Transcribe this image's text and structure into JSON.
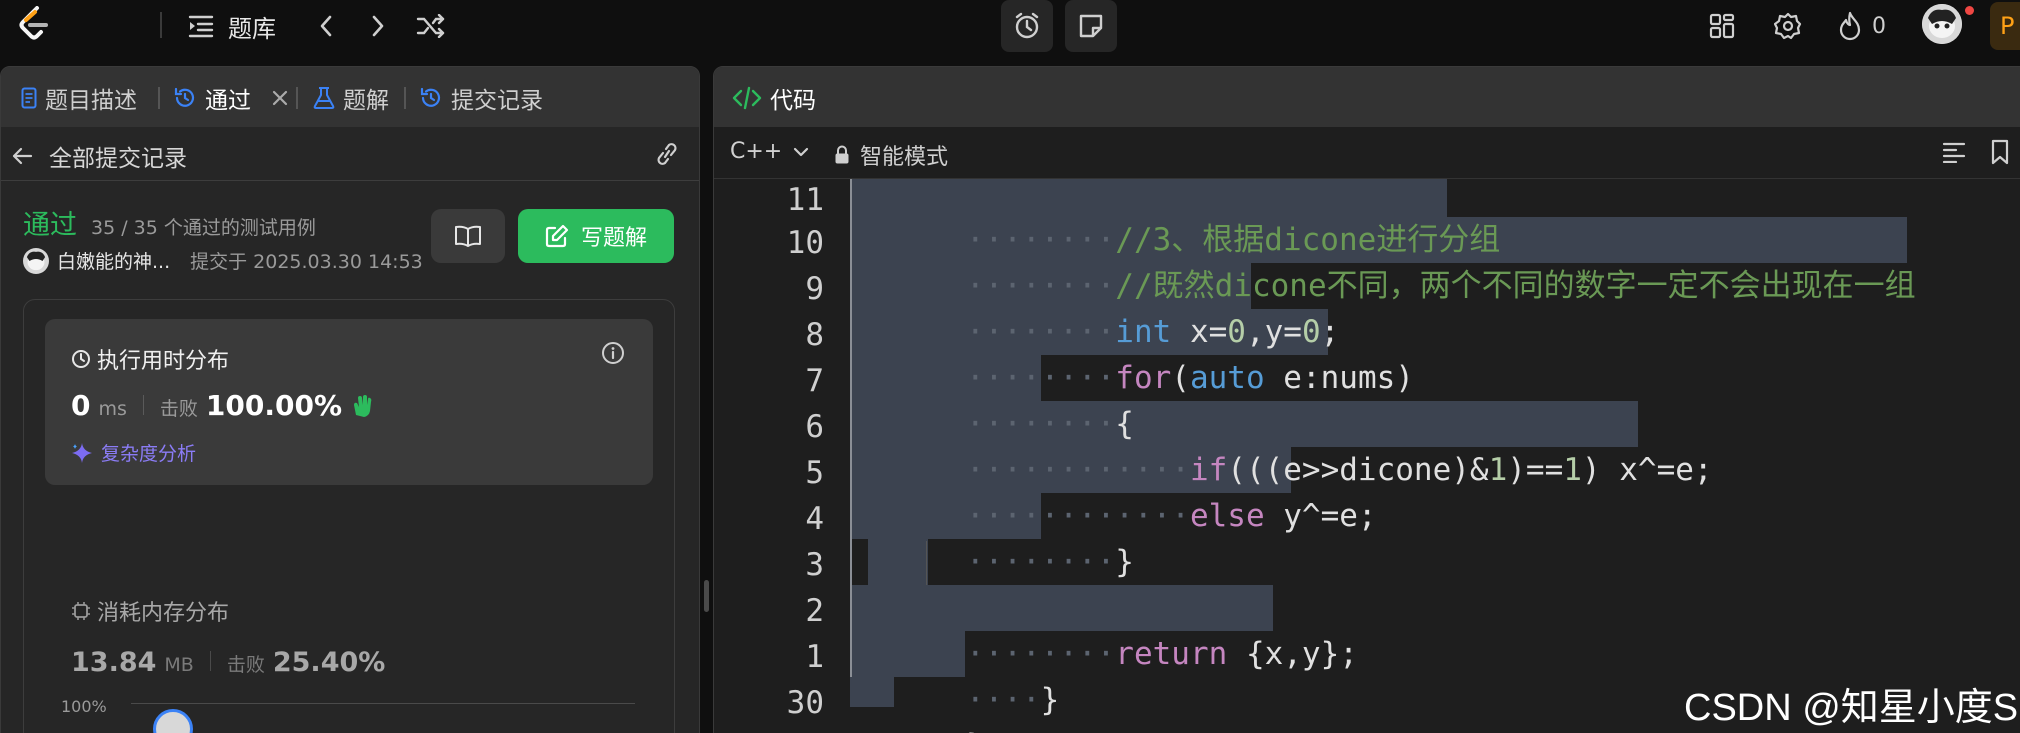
{
  "topbar": {
    "problem_list_label": "题库",
    "fire_count": "0",
    "premium_partial": "P"
  },
  "left_tabs": [
    {
      "label": "题目描述"
    },
    {
      "label": "通过"
    },
    {
      "label": "题解"
    },
    {
      "label": "提交记录"
    }
  ],
  "left_sub": {
    "back_label": "全部提交记录"
  },
  "submission": {
    "status": "通过",
    "cases": "35 / 35 个通过的测试用例",
    "user": "白嫩能的神...",
    "submitted_at": "提交于 2025.03.30 14:53",
    "write_solution_label": "写题解"
  },
  "runtime": {
    "title": "执行用时分布",
    "value": "0",
    "unit": "ms",
    "beats_label": "击败",
    "beats_value": "100.00%",
    "complexity_label": "复杂度分析"
  },
  "memory": {
    "title": "消耗内存分布",
    "value": "13.84",
    "unit": "MB",
    "beats_label": "击败",
    "beats_value": "25.40%"
  },
  "chart_axis_label": "100%",
  "code_panel": {
    "title": "代码",
    "language": "C++",
    "mode": "智能模式"
  },
  "code_lines": [
    {
      "num": "11"
    },
    {
      "num": "10"
    },
    {
      "num": "9"
    },
    {
      "num": "8"
    },
    {
      "num": "7"
    },
    {
      "num": "6"
    },
    {
      "num": "5"
    },
    {
      "num": "4"
    },
    {
      "num": "3"
    },
    {
      "num": "2"
    },
    {
      "num": "1"
    },
    {
      "num": "30"
    }
  ],
  "code_text": {
    "l11": "//3、根据dicone进行分组",
    "l10": "//既然dicone不同，两个不同的数字一定不会出现在一组",
    "l9_kw": "int",
    "l9_a": " x=",
    "l9_n1": "0",
    "l9_b": ",y=",
    "l9_n2": "0",
    "l9_c": ";",
    "l8_kw": "for",
    "l8_a": "(",
    "l8_kw2": "auto",
    "l8_b": " e:nums)",
    "l7": "{",
    "l6_kw": "if",
    "l6_a": "(((e>>dicone)&",
    "l6_n1": "1",
    "l6_b": ")==",
    "l6_n2": "1",
    "l6_c": ") x^=e;",
    "l5_kw": "else",
    "l5_a": " y^=e;",
    "l4": "}",
    "l2_kw": "return",
    "l2_a": " {x,y};",
    "l1": "}",
    "l30": "}"
  },
  "watermark": "CSDN @知星小度S"
}
